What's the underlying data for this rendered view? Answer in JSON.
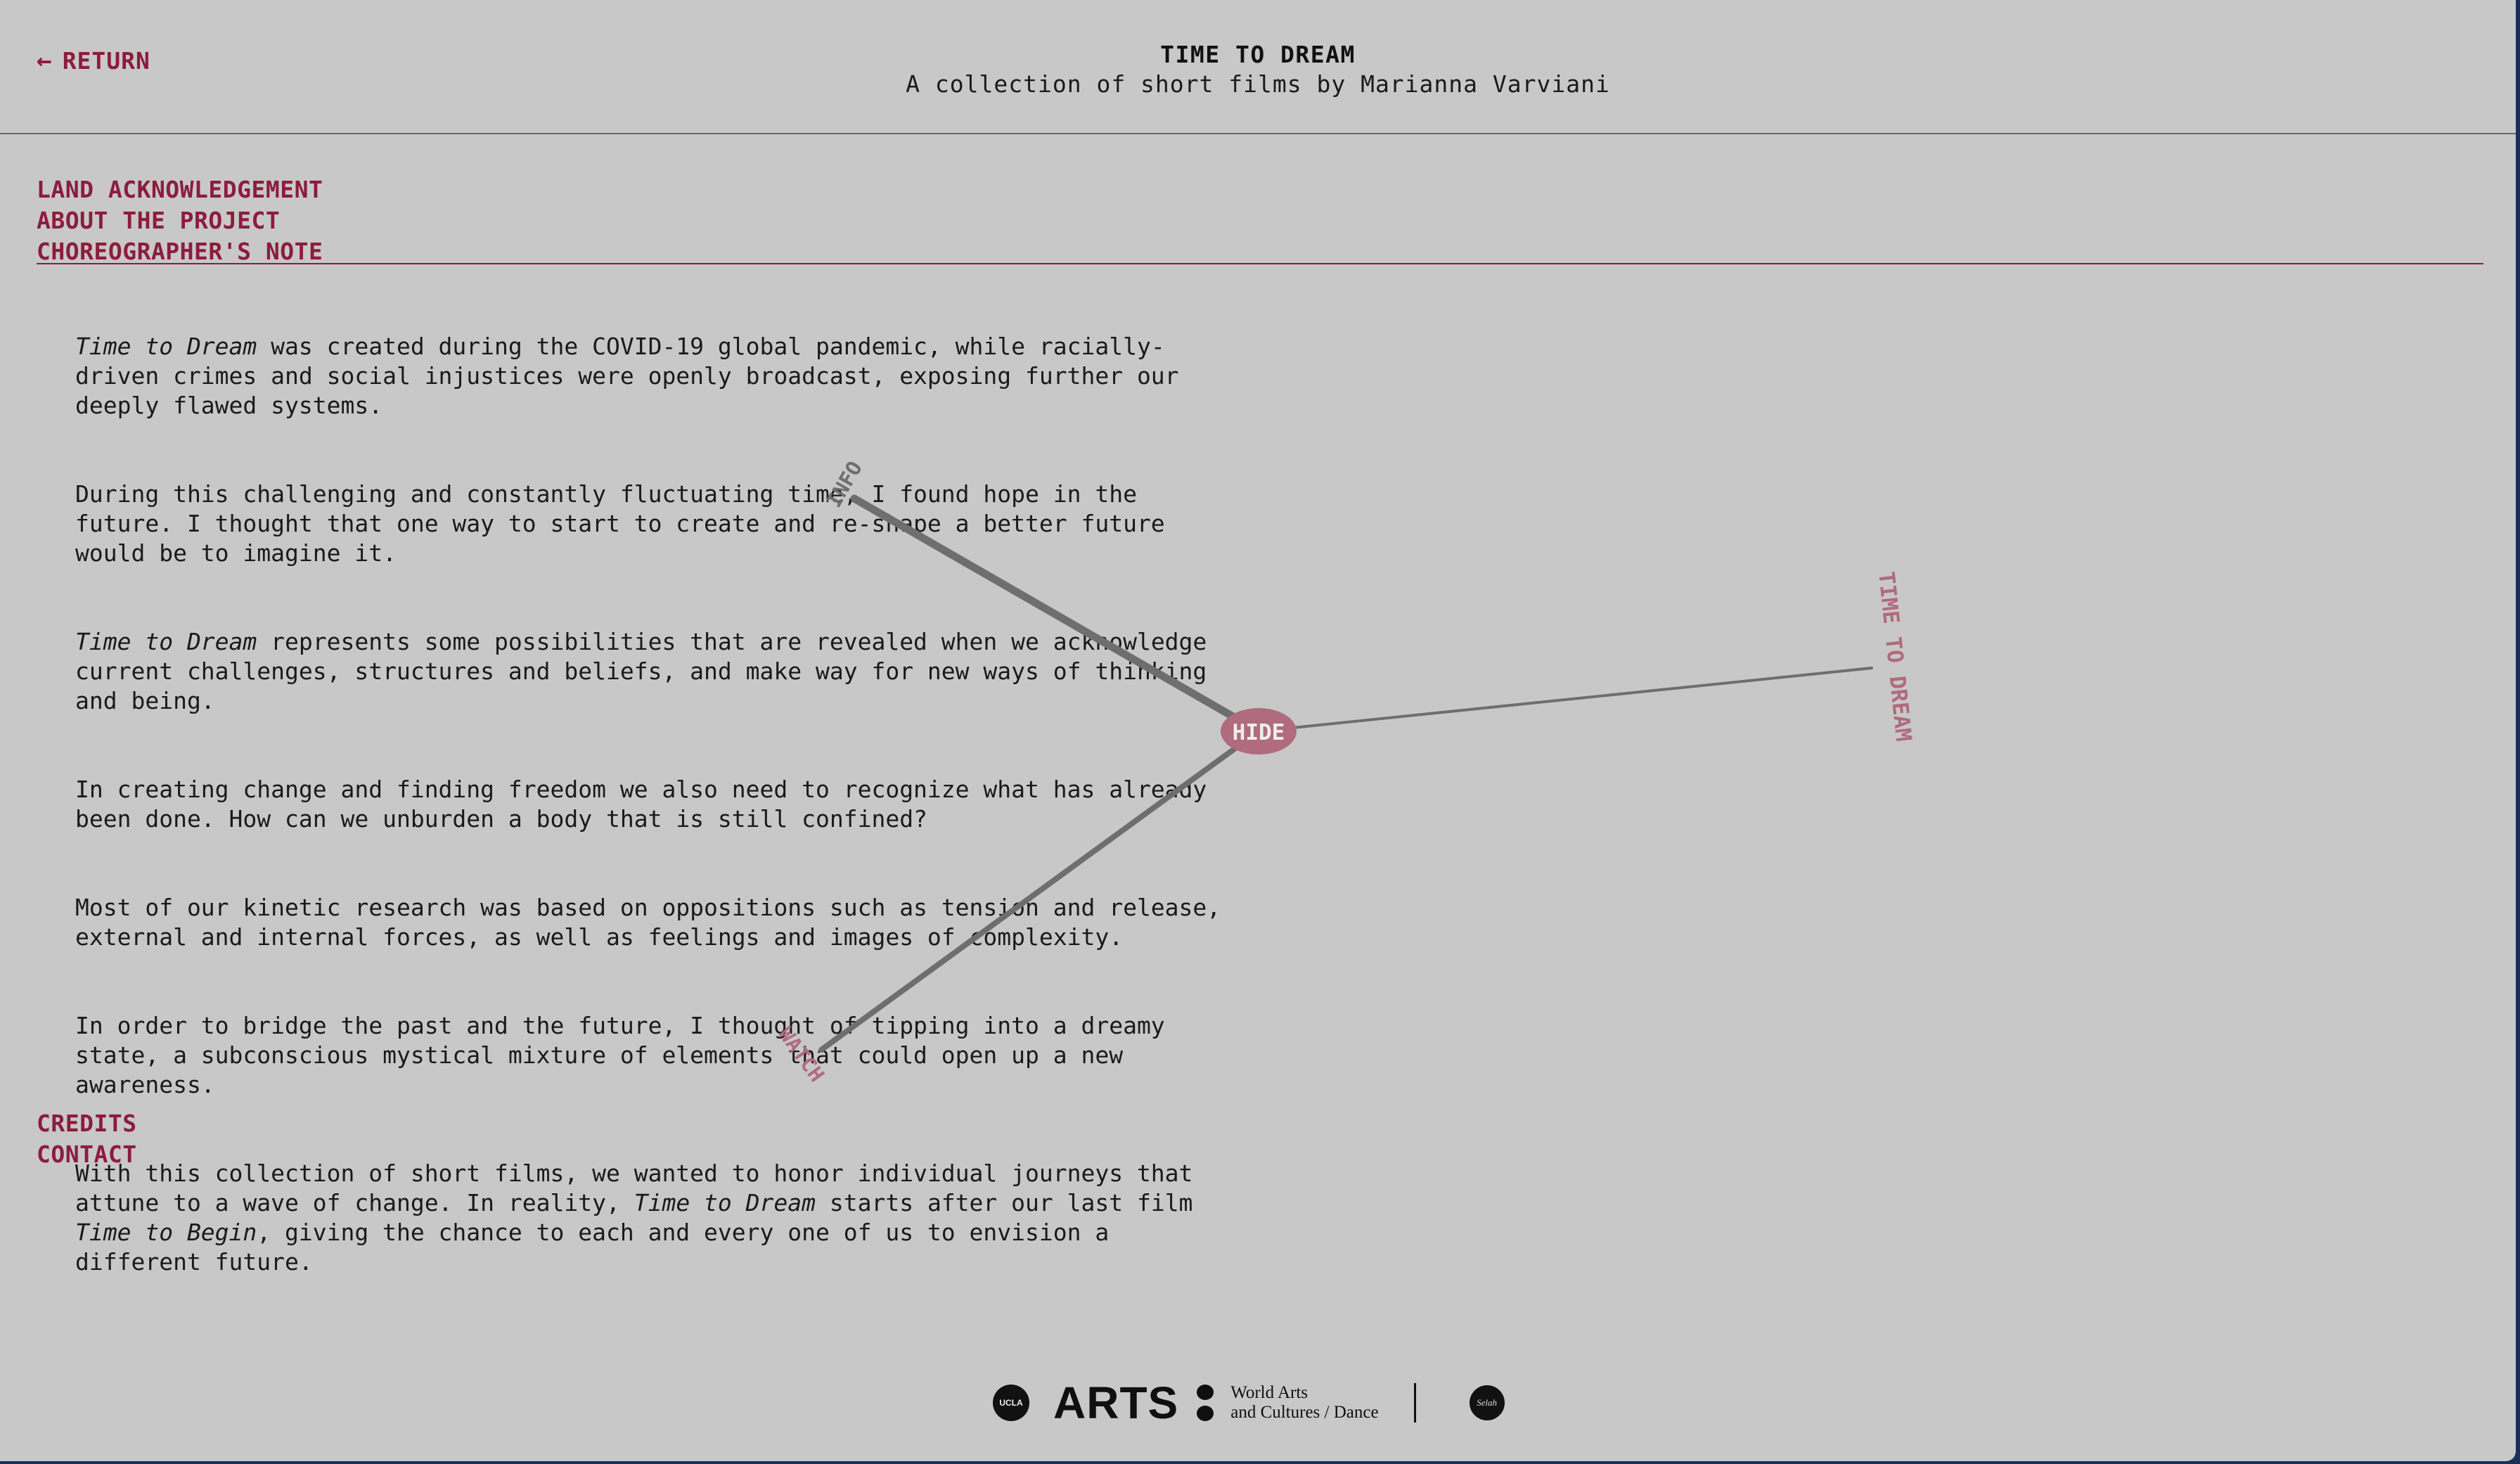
{
  "header": {
    "return_arrow": "←",
    "return_label": "RETURN",
    "title": "TIME TO DREAM",
    "subtitle": "A collection of short films by Marianna Varviani"
  },
  "nav": {
    "items": [
      {
        "label": "LAND ACKNOWLEDGEMENT"
      },
      {
        "label": "ABOUT THE PROJECT"
      },
      {
        "label": "CHOREOGRAPHER'S NOTE"
      }
    ]
  },
  "article": {
    "p1_em": "Time to Dream",
    "p1_rest": " was created during the COVID-19 global pandemic, while racially-\ndriven crimes and social injustices were openly broadcast, exposing further our\ndeeply flawed systems.",
    "p2": "During this challenging and constantly fluctuating time, I found hope in the\nfuture. I thought that one way to start to create and re-shape a better future\nwould be to imagine it.",
    "p3_em": "Time to Dream",
    "p3_rest": " represents some possibilities that are revealed when we acknowledge\ncurrent challenges, structures and beliefs, and make way for new ways of thinking\nand being.",
    "p4": "In creating change and finding freedom we also need to recognize what has already\nbeen done. How can we unburden a body that is still confined?",
    "p5": "Most of our kinetic research was based on oppositions such as tension and release,\nexternal and internal forces, as well as feelings and images of complexity.",
    "p6": "In order to bridge the past and the future, I thought of tipping into a dreamy\nstate, a subconscious mystical mixture of elements that could open up a new\nawareness.",
    "p7_a": "With this collection of short films, we wanted to honor individual journeys that\nattune to a wave of change. In reality, ",
    "p7_em1": "Time to Dream",
    "p7_b": " starts after our last film\n",
    "p7_em2": "Time to Begin",
    "p7_c": ", giving the chance to each and every one of us to envision a\ndifferent future."
  },
  "footer_nav": {
    "items": [
      {
        "label": "CREDITS"
      },
      {
        "label": "CONTACT"
      }
    ]
  },
  "radial_menu": {
    "center_label": "HIDE",
    "info_label": "INFO",
    "watch_label": "WATCH",
    "dream_label": "TIME TO DREAM",
    "accent_color": "#b06b7e",
    "line_color": "#6e6e6e"
  },
  "logos": {
    "ucla_badge": "UCLA",
    "arts_word": "ARTS",
    "department": "World Arts\nand Cultures / Dance",
    "partner_badge": "Selah"
  },
  "colors": {
    "page_bg": "#c8c8c8",
    "accent": "#8c1c3e",
    "text": "#1a1a1a"
  }
}
